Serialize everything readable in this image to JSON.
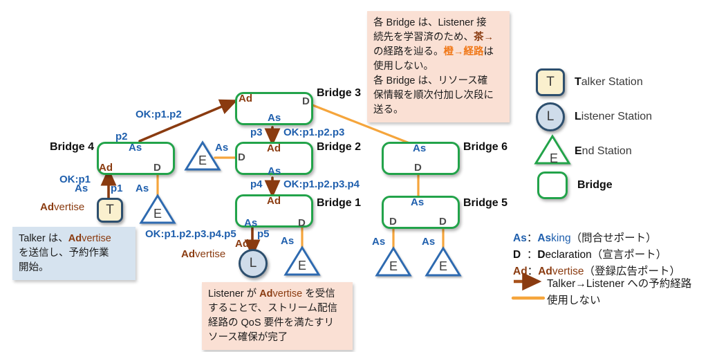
{
  "diagram": {
    "title_hidden": "",
    "colors": {
      "bridge_border": "#22a34a",
      "talker_fill": "#faf0ce",
      "talker_border": "#2d4f6e",
      "listener_fill": "#cfdcea",
      "endstation_border": "#1f5fad",
      "reserved_path": "#8a3b10",
      "unused_path": "#f5a53c",
      "asking_port": "#1f5fad",
      "declaration_port": "#4d4d4d",
      "advertise_port": "#8a3b10",
      "callout_peach": "#fae0d4",
      "callout_blue": "#d6e3ef",
      "accent_orange": "#f07818"
    }
  },
  "nodes": {
    "bridge4": {
      "label": "Bridge 4",
      "ports": {
        "as": "As",
        "d": "D",
        "ad": "Ad"
      }
    },
    "bridge3": {
      "label": "Bridge 3",
      "ports": {
        "as": "As",
        "d": "D",
        "ad": "Ad"
      }
    },
    "bridge2": {
      "label": "Bridge 2",
      "ports": {
        "as": "As",
        "d": "D",
        "ad": "Ad"
      }
    },
    "bridge1": {
      "label": "Bridge 1",
      "ports": {
        "as": "As",
        "d": "D",
        "ad": "Ad"
      }
    },
    "bridge6": {
      "label": "Bridge 6",
      "ports": {
        "as": "As",
        "d": "D"
      }
    },
    "bridge5": {
      "label": "Bridge 5",
      "ports": {
        "as": "As",
        "d_left": "D",
        "d_right": "D"
      }
    },
    "talker": {
      "label": "T",
      "port": "As",
      "link_label": "p1"
    },
    "listener": {
      "label": "L",
      "port": "Ad",
      "link_label": "p5"
    },
    "end_b4": {
      "label": "E",
      "port": "As"
    },
    "end_b2": {
      "label": "E",
      "port": "As"
    },
    "end_b1": {
      "label": "E",
      "port": "As"
    },
    "end_b5_left": {
      "label": "E",
      "port": "As"
    },
    "end_b5_right": {
      "label": "E",
      "port": "As"
    }
  },
  "link_labels": {
    "p1": "p1",
    "p2": "p2",
    "p3": "p3",
    "p4": "p4",
    "p5": "p5"
  },
  "ok_labels": {
    "ok_p1": "OK:p1",
    "ok_p1p2": "OK:p1.p2",
    "ok_p1p2p3": "OK:p1.p2.p3",
    "ok_p1p2p3p4": "OK:p1.p2.p3.p4",
    "ok_p1p2p3p4p5": "OK:p1.p2.p3.p4.p5"
  },
  "advertise_labels": {
    "talker_side": {
      "bold": "Ad",
      "rest": "vertise"
    },
    "listener_side": {
      "bold": "Ad",
      "rest": "vertise"
    }
  },
  "callouts": {
    "top_right": {
      "lines": [
        {
          "segments": [
            {
              "text": "各 Bridge は、Listener 接",
              "style": "plain"
            }
          ]
        },
        {
          "segments": [
            {
              "text": "続先を学習済のため、",
              "style": "plain"
            },
            {
              "text": "茶→",
              "style": "brown"
            }
          ]
        },
        {
          "segments": [
            {
              "text": "の経路を辿る。",
              "style": "plain"
            },
            {
              "text": "橙→経路",
              "style": "orange"
            },
            {
              "text": "は",
              "style": "plain"
            }
          ]
        },
        {
          "segments": [
            {
              "text": "使用しない。",
              "style": "plain"
            }
          ]
        },
        {
          "segments": [
            {
              "text": "各 Bridge は、リソース確",
              "style": "plain"
            }
          ]
        },
        {
          "segments": [
            {
              "text": "保情報を順次付加し次段に",
              "style": "plain"
            }
          ]
        },
        {
          "segments": [
            {
              "text": "送る。",
              "style": "plain"
            }
          ]
        }
      ]
    },
    "bottom_left": {
      "lines": [
        {
          "segments": [
            {
              "text": "Talker は、",
              "style": "plain"
            },
            {
              "text": "Ad",
              "style": "brown"
            },
            {
              "text": "vertise",
              "style": "brown-light"
            }
          ]
        },
        {
          "segments": [
            {
              "text": "を送信し、予約作業",
              "style": "plain"
            }
          ]
        },
        {
          "segments": [
            {
              "text": "開始。",
              "style": "plain"
            }
          ]
        }
      ]
    },
    "bottom_center": {
      "lines": [
        {
          "segments": [
            {
              "text": "Listener が ",
              "style": "plain"
            },
            {
              "text": "Ad",
              "style": "brown"
            },
            {
              "text": "vertise",
              "style": "brown-light"
            },
            {
              "text": " を受信",
              "style": "plain"
            }
          ]
        },
        {
          "segments": [
            {
              "text": "することで、ストリーム配信",
              "style": "plain"
            }
          ]
        },
        {
          "segments": [
            {
              "text": "経路の QoS 要件を満たすリ",
              "style": "plain"
            }
          ]
        },
        {
          "segments": [
            {
              "text": "ソース確保が完了",
              "style": "plain"
            }
          ]
        }
      ]
    }
  },
  "legend": {
    "shapes": [
      {
        "icon": "talker-station-icon",
        "glyph": "T",
        "bold": "T",
        "rest": "alker Station"
      },
      {
        "icon": "listener-station-icon",
        "glyph": "L",
        "bold": "L",
        "rest": "istener Station"
      },
      {
        "icon": "end-station-icon",
        "glyph": "E",
        "bold": "E",
        "rest": "nd Station"
      },
      {
        "icon": "bridge-icon",
        "glyph": "",
        "bold": "Bridge",
        "rest": ""
      }
    ],
    "keys": [
      {
        "abbr": "As",
        "colon": "：",
        "bold": "As",
        "rest": "king",
        "paren": "（問合せポート）",
        "color_class": "k-as"
      },
      {
        "abbr": "D",
        "colon": "：",
        "bold": "D",
        "rest": "eclaration",
        "paren": "（宣言ポート）",
        "color_class": "k-d"
      },
      {
        "abbr": "Ad",
        "colon": "：",
        "bold": "Ad",
        "rest": "vertise",
        "paren": "（登録広告ポート）",
        "color_class": "k-ad"
      }
    ],
    "lines": [
      {
        "icon": "reserved-path-arrow-icon",
        "text": "Talker→Listener への予約経路",
        "color": "#8a3b10"
      },
      {
        "icon": "unused-path-line-icon",
        "text": "使用しない",
        "color": "#f5a53c"
      }
    ]
  }
}
